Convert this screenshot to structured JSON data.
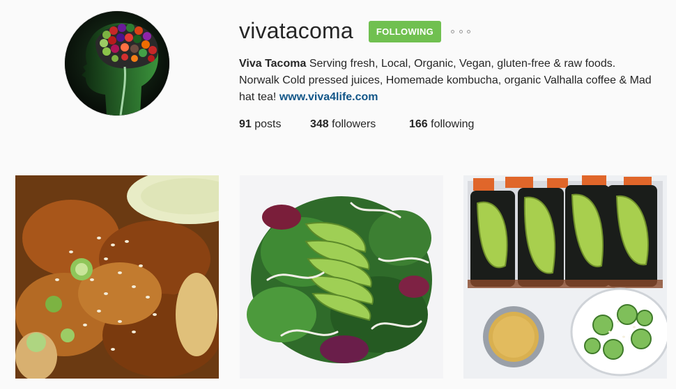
{
  "profile": {
    "username": "vivatacoma",
    "follow_button_label": "FOLLOWING",
    "more_options_icon": "ellipsis-icon",
    "bio": {
      "display_name": "Viva Tacoma",
      "text": "Serving fresh, Local, Organic, Vegan, gluten-free & raw foods. Norwalk Cold pressed juices, Homemade kombucha, organic Valhalla coffee & Mad hat tea!",
      "website": "www.viva4life.com"
    },
    "stats": {
      "posts_count": "91",
      "posts_label": "posts",
      "followers_count": "348",
      "followers_label": "followers",
      "following_count": "166",
      "following_label": "following"
    }
  },
  "colors": {
    "follow_button": "#70c050",
    "link": "#125688",
    "background": "#fafafa"
  },
  "posts": [
    {
      "subject": "sesame glazed cauliflower"
    },
    {
      "subject": "avocado salad"
    },
    {
      "subject": "avocado nori rolls"
    }
  ]
}
